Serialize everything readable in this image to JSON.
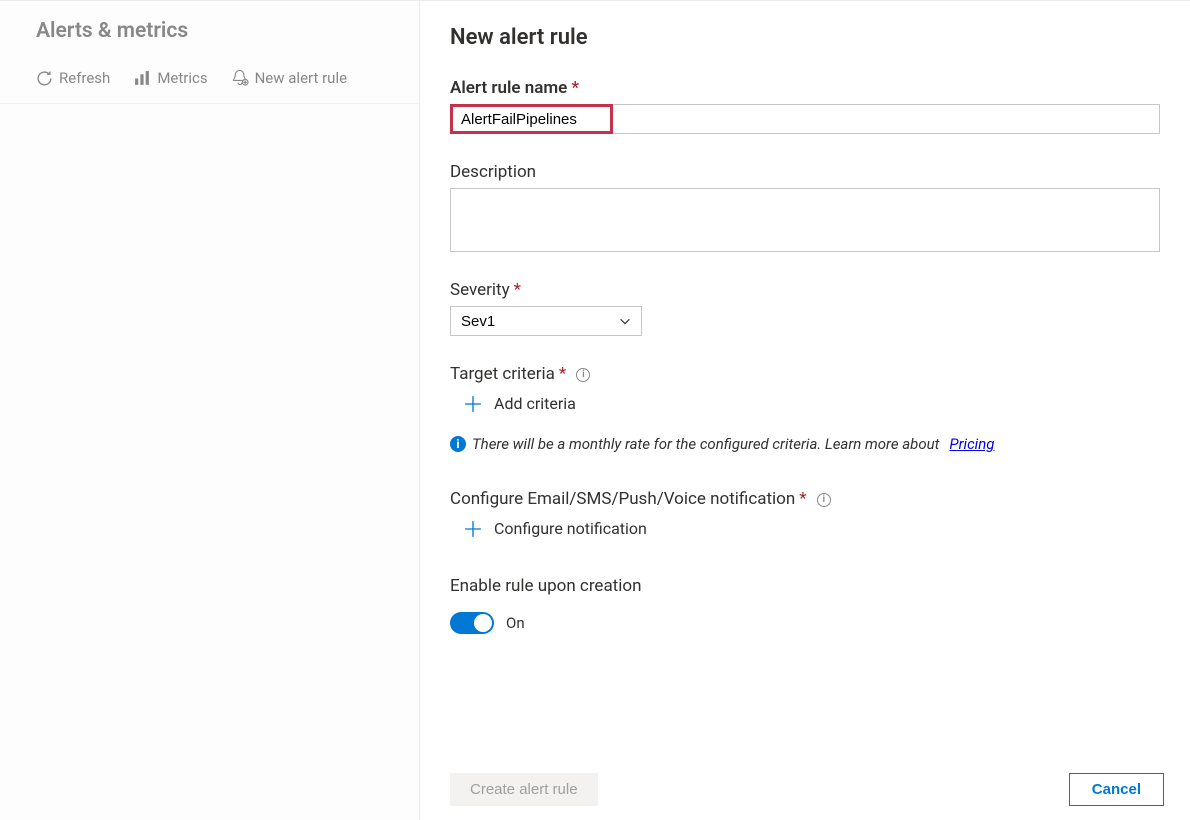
{
  "sidebar": {
    "title": "Alerts & metrics",
    "actions": {
      "refresh": "Refresh",
      "metrics": "Metrics",
      "new_rule": "New alert rule"
    }
  },
  "panel": {
    "title": "New alert rule",
    "alert_name": {
      "label": "Alert rule name",
      "value": "AlertFailPipelines"
    },
    "description": {
      "label": "Description",
      "value": ""
    },
    "severity": {
      "label": "Severity",
      "value": "Sev1"
    },
    "target_criteria": {
      "label": "Target criteria",
      "add_label": "Add criteria"
    },
    "pricing_info": {
      "text": "There will be a monthly rate for the configured criteria. Learn more about",
      "link": "Pricing"
    },
    "notification": {
      "label": "Configure Email/SMS/Push/Voice notification",
      "add_label": "Configure notification"
    },
    "enable_rule": {
      "label": "Enable rule upon creation",
      "state_label": "On",
      "enabled": true
    },
    "buttons": {
      "create": "Create alert rule",
      "cancel": "Cancel"
    }
  }
}
